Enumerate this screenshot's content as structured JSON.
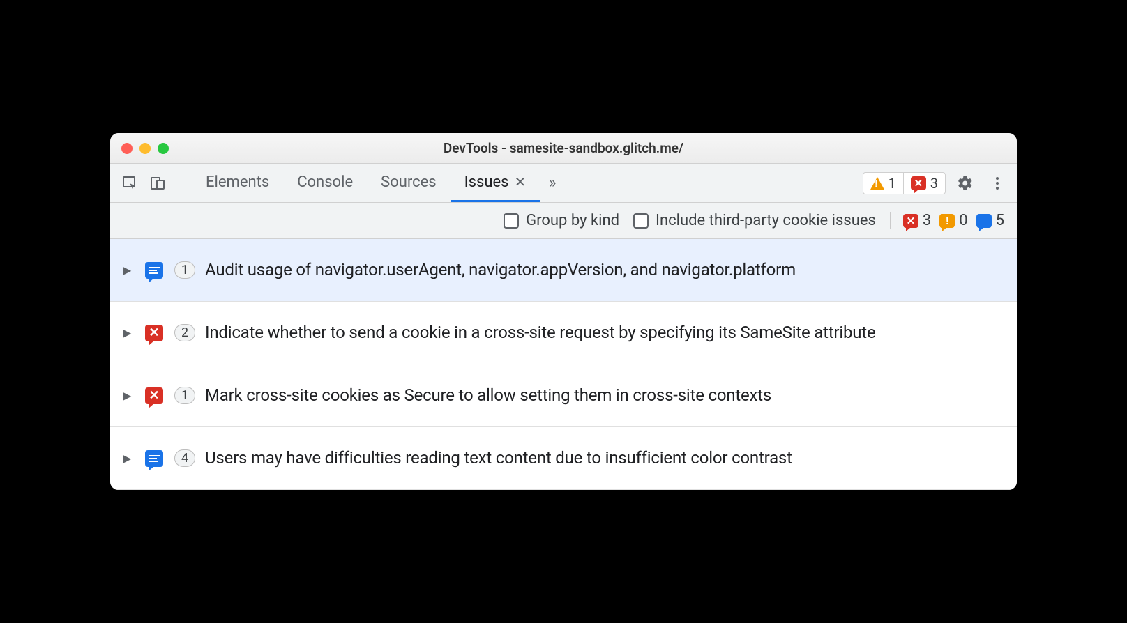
{
  "window": {
    "title": "DevTools - samesite-sandbox.glitch.me/"
  },
  "tabs": {
    "items": [
      "Elements",
      "Console",
      "Sources",
      "Issues"
    ],
    "active": "Issues"
  },
  "toolbar_counters": {
    "warnings": 1,
    "errors": 3
  },
  "filterbar": {
    "group_by_kind_label": "Group by kind",
    "include_third_party_label": "Include third-party cookie issues",
    "counts": {
      "errors": 3,
      "warnings": 0,
      "info": 5
    }
  },
  "issues": [
    {
      "kind": "info",
      "count": 1,
      "title": "Audit usage of navigator.userAgent, navigator.appVersion, and navigator.platform",
      "selected": true
    },
    {
      "kind": "error",
      "count": 2,
      "title": "Indicate whether to send a cookie in a cross-site request by specifying its SameSite attribute",
      "selected": false
    },
    {
      "kind": "error",
      "count": 1,
      "title": "Mark cross-site cookies as Secure to allow setting them in cross-site contexts",
      "selected": false
    },
    {
      "kind": "info",
      "count": 4,
      "title": "Users may have difficulties reading text content due to insufficient color contrast",
      "selected": false
    }
  ]
}
